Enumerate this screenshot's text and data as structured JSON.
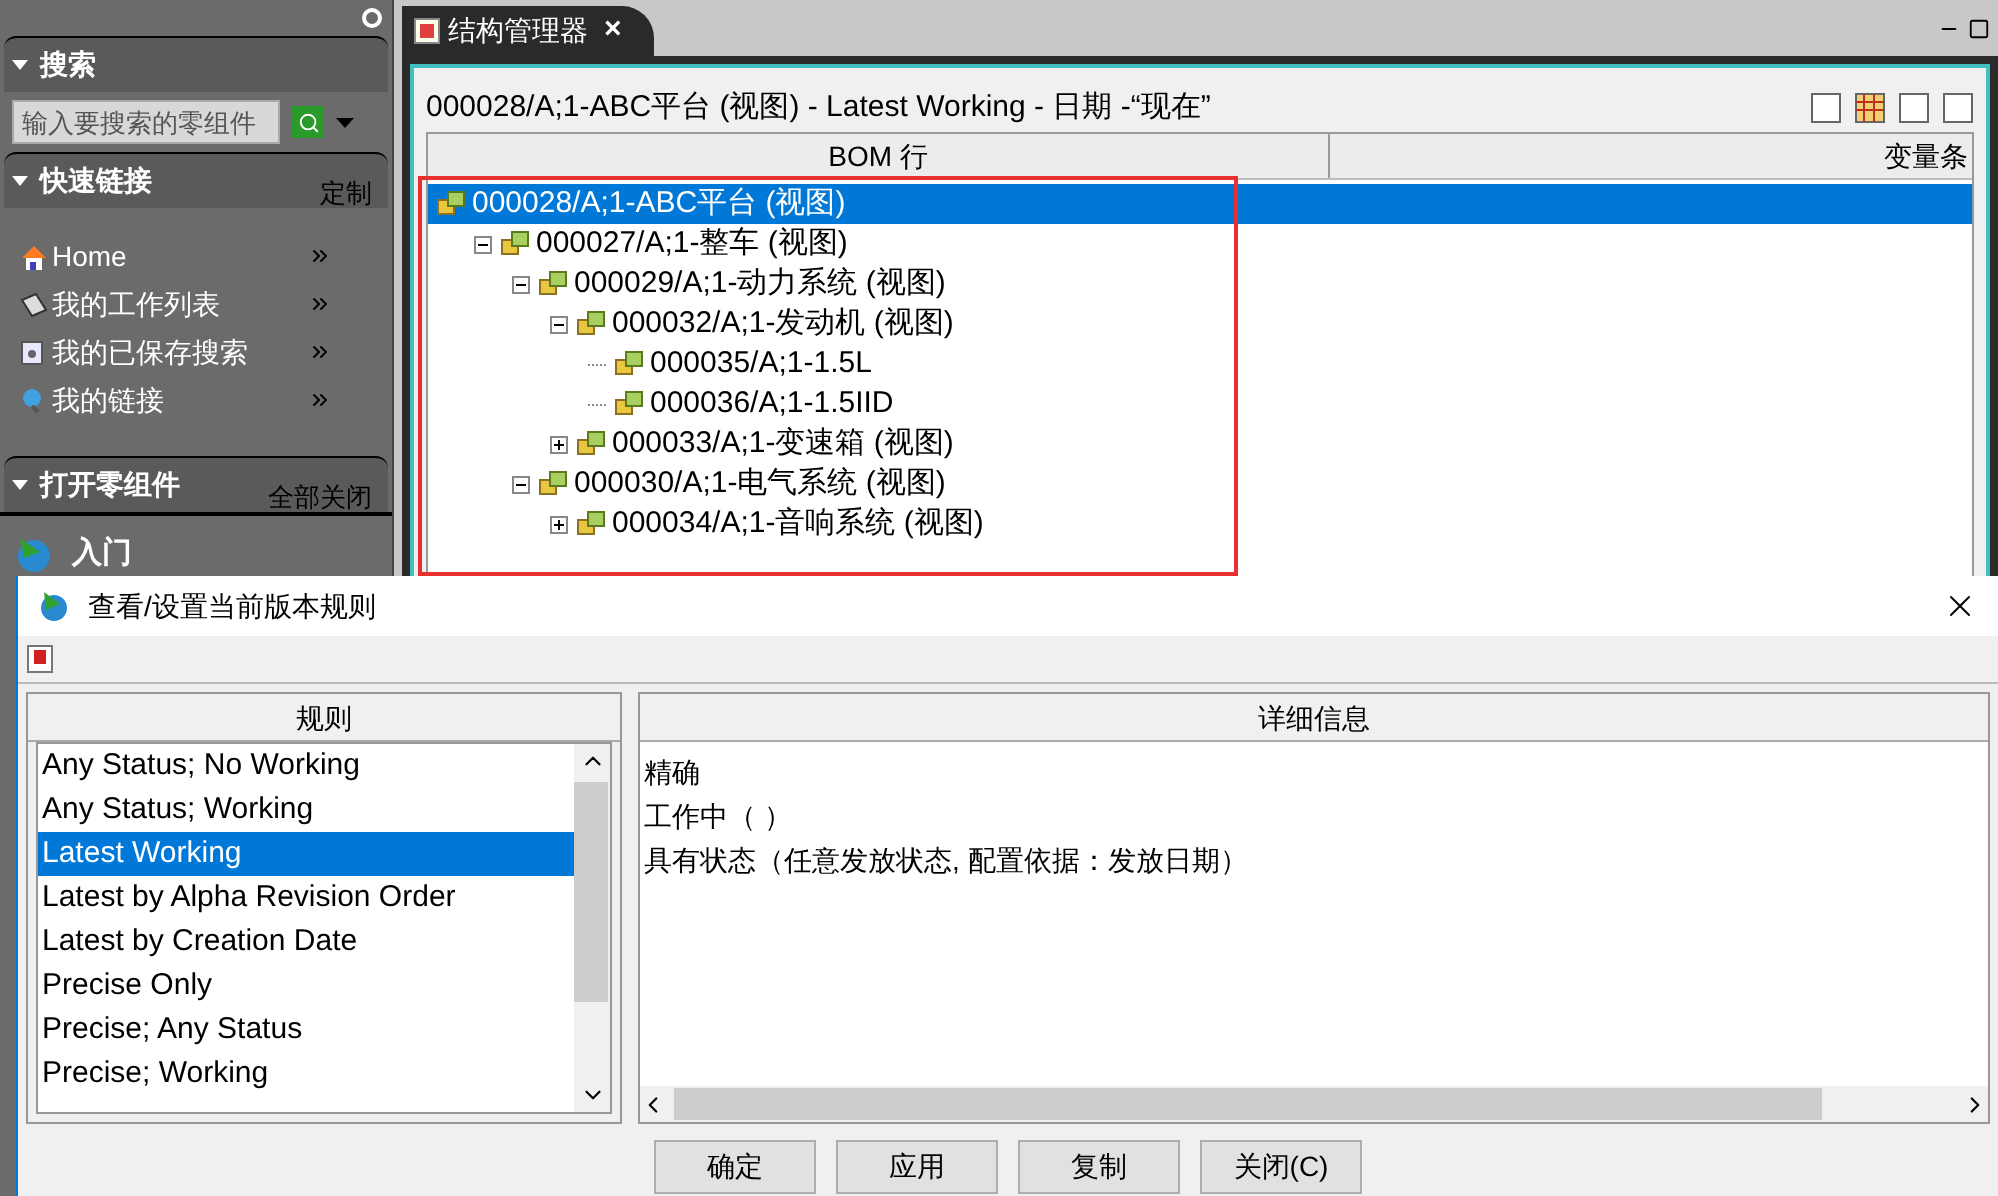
{
  "sidebar": {
    "search": {
      "title": "搜索",
      "placeholder": "输入要搜索的零组件"
    },
    "quick_links": {
      "title": "快速链接",
      "action": "定制",
      "items": [
        {
          "label": "Home",
          "kind": "home"
        },
        {
          "label": "我的工作列表",
          "kind": "worklist"
        },
        {
          "label": "我的已保存搜索",
          "kind": "saved"
        },
        {
          "label": "我的链接",
          "kind": "links"
        }
      ]
    },
    "open_parts": {
      "title": "打开零组件",
      "action": "全部关闭"
    },
    "getting_started": {
      "label": "入门"
    }
  },
  "tab": {
    "label": "结构管理器",
    "close": "×"
  },
  "structure": {
    "title": "000028/A;1-ABC平台 (视图) - Latest Working - 日期 -“现在”",
    "columns": [
      "BOM 行",
      "变量条"
    ],
    "tree": [
      {
        "label": "000028/A;1-ABC平台 (视图)",
        "selected": true,
        "children": [
          {
            "label": "000027/A;1-整车 (视图)",
            "selected": false,
            "expanded": true,
            "children": [
              {
                "label": "000029/A;1-动力系统 (视图)",
                "selected": false,
                "expanded": true,
                "children": [
                  {
                    "label": "000032/A;1-发动机 (视图)",
                    "selected": false,
                    "expanded": true,
                    "children": [
                      {
                        "label": "000035/A;1-1.5L",
                        "selected": false
                      },
                      {
                        "label": "000036/A;1-1.5IID",
                        "selected": false
                      }
                    ]
                  },
                  {
                    "label": "000033/A;1-变速箱 (视图)",
                    "selected": false,
                    "expanded": false
                  }
                ]
              },
              {
                "label": "000030/A;1-电气系统 (视图)",
                "selected": false,
                "expanded": true,
                "children": [
                  {
                    "label": "000034/A;1-音响系统 (视图)",
                    "selected": false,
                    "expanded": false
                  }
                ]
              }
            ]
          }
        ]
      }
    ]
  },
  "dialog": {
    "title": "查看/设置当前版本规则",
    "rules": {
      "header": "规则",
      "items": [
        {
          "label": "Any Status; No Working",
          "selected": false
        },
        {
          "label": "Any Status; Working",
          "selected": false
        },
        {
          "label": "Latest Working",
          "selected": true
        },
        {
          "label": "Latest by Alpha Revision Order",
          "selected": false
        },
        {
          "label": "Latest by Creation Date",
          "selected": false
        },
        {
          "label": "Precise Only",
          "selected": false
        },
        {
          "label": "Precise; Any Status",
          "selected": false
        },
        {
          "label": "Precise; Working",
          "selected": false
        }
      ]
    },
    "details": {
      "header": "详细信息",
      "lines": [
        "精确",
        "工作中（  ）",
        "具有状态（任意发放状态, 配置依据：发放日期）"
      ]
    },
    "buttons": [
      "确定",
      "应用",
      "复制",
      "关闭(C)"
    ]
  }
}
